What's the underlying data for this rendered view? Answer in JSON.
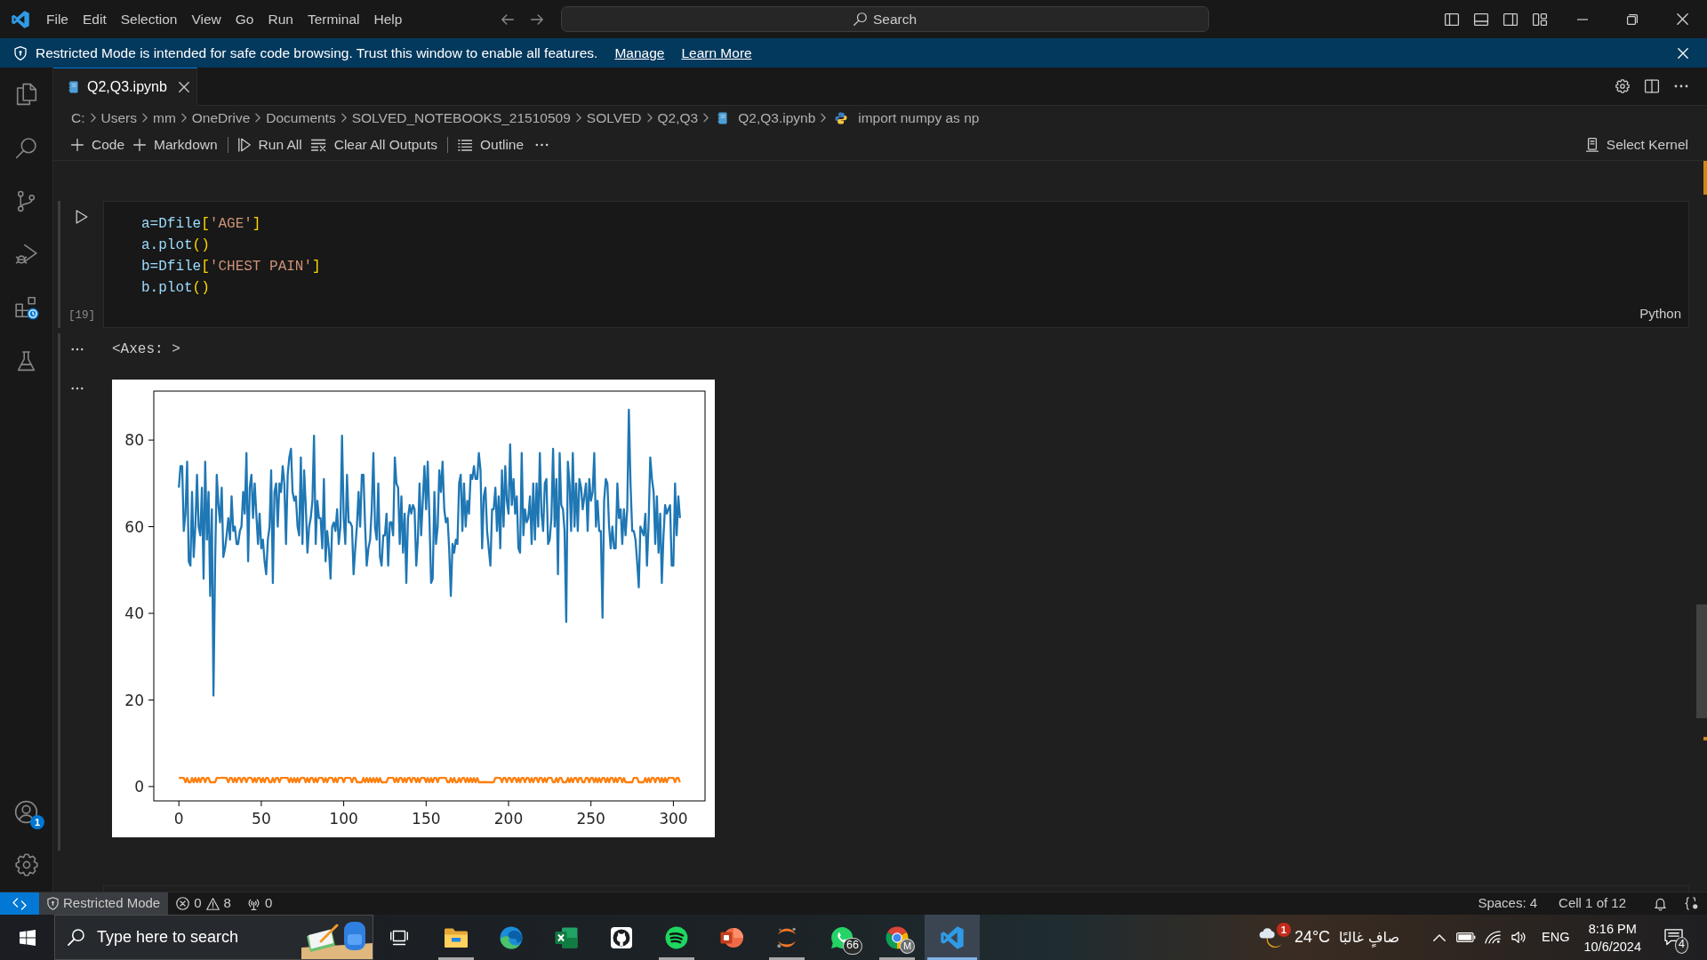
{
  "title_bar": {
    "menu": [
      "File",
      "Edit",
      "Selection",
      "View",
      "Go",
      "Run",
      "Terminal",
      "Help"
    ],
    "command_center": "Search"
  },
  "banner": {
    "message": "Restricted Mode is intended for safe code browsing. Trust this window to enable all features.",
    "links": [
      "Manage",
      "Learn More"
    ]
  },
  "activity_bar": {
    "accounts_badge": "1"
  },
  "tabs": [
    {
      "label": "Q2,Q3.ipynb",
      "selected": true
    }
  ],
  "breadcrumbs": [
    {
      "label": "C:",
      "kind": "folder"
    },
    {
      "label": "Users",
      "kind": "folder"
    },
    {
      "label": "mm",
      "kind": "folder"
    },
    {
      "label": "OneDrive",
      "kind": "folder"
    },
    {
      "label": "Documents",
      "kind": "folder"
    },
    {
      "label": "SOLVED_NOTEBOOKS_21510509",
      "kind": "folder"
    },
    {
      "label": "SOLVED",
      "kind": "folder"
    },
    {
      "label": "Q2,Q3",
      "kind": "folder"
    },
    {
      "label": "Q2,Q3.ipynb",
      "kind": "notebook"
    },
    {
      "label": "import numpy as np",
      "kind": "symbol"
    }
  ],
  "notebook_toolbar": {
    "groups": [
      [
        {
          "label": "Code",
          "kind": "add"
        },
        {
          "label": "Markdown",
          "kind": "add"
        }
      ],
      [
        {
          "label": "Run All",
          "kind": "run"
        },
        {
          "label": "Clear All Outputs",
          "kind": "clear"
        }
      ],
      [
        {
          "label": "Outline",
          "kind": "outline"
        }
      ]
    ],
    "kernel": "Select Kernel"
  },
  "cells": [
    {
      "execution_count": "[19]",
      "language": "Python",
      "code": [
        [
          {
            "text": "a=Dfile",
            "kind": "name"
          },
          {
            "text": "[",
            "kind": "bracket"
          },
          {
            "text": "'AGE'",
            "kind": "string"
          },
          {
            "text": "]",
            "kind": "bracket"
          }
        ],
        [
          {
            "text": "a.plot",
            "kind": "name"
          },
          {
            "text": "()",
            "kind": "bracket"
          }
        ],
        [
          {
            "text": "b=Dfile",
            "kind": "name"
          },
          {
            "text": "[",
            "kind": "bracket"
          },
          {
            "text": "'CHEST PAIN'",
            "kind": "string"
          },
          {
            "text": "]",
            "kind": "bracket"
          }
        ],
        [
          {
            "text": "b.plot",
            "kind": "name"
          },
          {
            "text": "()",
            "kind": "bracket"
          }
        ]
      ],
      "outputs": [
        {
          "kind": "text",
          "text": "<Axes: >"
        },
        {
          "kind": "image",
          "chart_data": {
            "type": "line",
            "xlim": [
              -15.2,
              319.2
            ],
            "ylim": [
              -3.3,
              91.3
            ],
            "xticks": [
              0,
              50,
              100,
              150,
              200,
              250,
              300
            ],
            "yticks": [
              0,
              20,
              40,
              60,
              80
            ],
            "x": [
              0,
              1,
              2,
              3,
              4,
              5,
              6,
              7,
              8,
              9,
              10,
              11,
              12,
              13,
              14,
              15,
              16,
              17,
              18,
              19,
              20,
              21,
              22,
              23,
              24,
              25,
              26,
              27,
              28,
              29,
              30,
              31,
              32,
              33,
              34,
              35,
              36,
              37,
              38,
              39,
              40,
              41,
              42,
              43,
              44,
              45,
              46,
              47,
              48,
              49,
              50,
              51,
              52,
              53,
              54,
              55,
              56,
              57,
              58,
              59,
              60,
              61,
              62,
              63,
              64,
              65,
              66,
              67,
              68,
              69,
              70,
              71,
              72,
              73,
              74,
              75,
              76,
              77,
              78,
              79,
              80,
              81,
              82,
              83,
              84,
              85,
              86,
              87,
              88,
              89,
              90,
              91,
              92,
              93,
              94,
              95,
              96,
              97,
              98,
              99,
              100,
              101,
              102,
              103,
              104,
              105,
              106,
              107,
              108,
              109,
              110,
              111,
              112,
              113,
              114,
              115,
              116,
              117,
              118,
              119,
              120,
              121,
              122,
              123,
              124,
              125,
              126,
              127,
              128,
              129,
              130,
              131,
              132,
              133,
              134,
              135,
              136,
              137,
              138,
              139,
              140,
              141,
              142,
              143,
              144,
              145,
              146,
              147,
              148,
              149,
              150,
              151,
              152,
              153,
              154,
              155,
              156,
              157,
              158,
              159,
              160,
              161,
              162,
              163,
              164,
              165,
              166,
              167,
              168,
              169,
              170,
              171,
              172,
              173,
              174,
              175,
              176,
              177,
              178,
              179,
              180,
              181,
              182,
              183,
              184,
              185,
              186,
              187,
              188,
              189,
              190,
              191,
              192,
              193,
              194,
              195,
              196,
              197,
              198,
              199,
              200,
              201,
              202,
              203,
              204,
              205,
              206,
              207,
              208,
              209,
              210,
              211,
              212,
              213,
              214,
              215,
              216,
              217,
              218,
              219,
              220,
              221,
              222,
              223,
              224,
              225,
              226,
              227,
              228,
              229,
              230,
              231,
              232,
              233,
              234,
              235,
              236,
              237,
              238,
              239,
              240,
              241,
              242,
              243,
              244,
              245,
              246,
              247,
              248,
              249,
              250,
              251,
              252,
              253,
              254,
              255,
              256,
              257,
              258,
              259,
              260,
              261,
              262,
              263,
              264,
              265,
              266,
              267,
              268,
              269,
              270,
              271,
              272,
              273,
              274,
              275,
              276,
              277,
              278,
              279,
              280,
              281,
              282,
              283,
              284,
              285,
              286,
              287,
              288,
              289,
              290,
              291,
              292,
              293,
              294,
              295,
              296,
              297,
              298,
              299,
              300,
              301,
              302,
              303,
              304
            ],
            "series": [
              {
                "color": "#1f77b4",
                "values": [
                  69,
                  74,
                  74,
                  59,
                  63,
                  75,
                  52,
                  51,
                  68,
                  53,
                  60,
                  72,
                  60,
                  58,
                  69,
                  48,
                  75,
                  57,
                  68,
                  44,
                  64,
                  21,
                  52,
                  72,
                  65,
                  61,
                  69,
                  53,
                  55,
                  58,
                  62,
                  57,
                  67,
                  59,
                  60,
                  56,
                  56,
                  59,
                  60,
                  68,
                  63,
                  77,
                  52,
                  69,
                  72,
                  62,
                  70,
                  63,
                  56,
                  63,
                  55,
                  57,
                  52,
                  49,
                  57,
                  60,
                  73,
                  47,
                  68,
                  70,
                  60,
                  70,
                  68,
                  74,
                  70,
                  56,
                  72,
                  76,
                  78,
                  68,
                  66,
                  67,
                  60,
                  58,
                  76,
                  56,
                  73,
                  65,
                  54,
                  60,
                  62,
                  66,
                  81,
                  56,
                  66,
                  62,
                  62,
                  55,
                  71,
                  52,
                  59,
                  55,
                  48,
                  60,
                  61,
                  59,
                  64,
                  56,
                  60,
                  81,
                  62,
                  56,
                  72,
                  61,
                  61,
                  60,
                  49,
                  55,
                  60,
                  68,
                  60,
                  72,
                  72,
                  60,
                  51,
                  55,
                  57,
                  64,
                  77,
                  60,
                  57,
                  70,
                  53,
                  51,
                  58,
                  58,
                  63,
                  51,
                  61,
                  61,
                  58,
                  76,
                  70,
                  69,
                  56,
                  67,
                  54,
                  63,
                  47,
                  62,
                  65,
                  63,
                  65,
                  64,
                  51,
                  57,
                  70,
                  58,
                  66,
                  74,
                  64,
                  75,
                  62,
                  47,
                  48,
                  68,
                  56,
                  60,
                  73,
                  68,
                  75,
                  64,
                  61,
                  62,
                  55,
                  44,
                  56,
                  54,
                  57,
                  56,
                  70,
                  72,
                  59,
                  70,
                  60,
                  66,
                  63,
                  72,
                  71,
                  74,
                  71,
                  71,
                  77,
                  73,
                  55,
                  67,
                  69,
                  59,
                  55,
                  51,
                  64,
                  64,
                  69,
                  59,
                  67,
                  55,
                  73,
                  60,
                  74,
                  66,
                  63,
                  79,
                  65,
                  71,
                  63,
                  67,
                  55,
                  54,
                  77,
                  58,
                  64,
                  61,
                  62,
                  67,
                  56,
                  70,
                  57,
                  70,
                  60,
                  77,
                  63,
                  59,
                  70,
                  71,
                  56,
                  57,
                  62,
                  78,
                  60,
                  71,
                  49,
                  77,
                  65,
                  64,
                  59,
                  38,
                  75,
                  70,
                  59,
                  77,
                  60,
                  70,
                  59,
                  71,
                  69,
                  64,
                  67,
                  70,
                  59,
                  71,
                  66,
                  68,
                  77,
                  60,
                  66,
                  59,
                  59,
                  39,
                  66,
                  71,
                  70,
                  60,
                  55,
                  60,
                  55,
                  55,
                  70,
                  62,
                  64,
                  56,
                  64,
                  58,
                  64,
                  87,
                  70,
                  59,
                  59,
                  57,
                  52,
                  46,
                  60,
                  59,
                  58,
                  63,
                  51,
                  61,
                  76,
                  71,
                  68,
                  56,
                  67,
                  54,
                  63,
                  47,
                  58,
                  65,
                  63,
                  64,
                  65,
                  51,
                  51,
                  70,
                  58,
                  67,
                  62
                ]
              },
              {
                "color": "#ff7f0e",
                "values": [
                  2,
                  2,
                  2,
                  2,
                  1,
                  2,
                  1,
                  1,
                  2,
                  1,
                  2,
                  1,
                  2,
                  1,
                  2,
                  2,
                  1,
                  2,
                  2,
                  1,
                  1,
                  1,
                  1,
                  2,
                  2,
                  2,
                  2,
                  2,
                  2,
                  2,
                  1,
                  2,
                  2,
                  1,
                  2,
                  1,
                  2,
                  2,
                  1,
                  2,
                  2,
                  1,
                  2,
                  2,
                  2,
                  1,
                  2,
                  1,
                  2,
                  2,
                  1,
                  2,
                  1,
                  2,
                  2,
                  1,
                  1,
                  2,
                  1,
                  2,
                  2,
                  1,
                  2,
                  2,
                  2,
                  2,
                  2,
                  1,
                  2,
                  1,
                  2,
                  1,
                  2,
                  1,
                  2,
                  2,
                  2,
                  1,
                  2,
                  1,
                  2,
                  2,
                  1,
                  2,
                  1,
                  2,
                  2,
                  2,
                  1,
                  2,
                  1,
                  2,
                  2,
                  2,
                  1,
                  2,
                  1,
                  2,
                  2,
                  2,
                  1,
                  2,
                  2,
                  2,
                  2,
                  1,
                  2,
                  2,
                  1,
                  1,
                  1,
                  1,
                  2,
                  1,
                  2,
                  1,
                  2,
                  1,
                  2,
                  1,
                  2,
                  1,
                  2,
                  1,
                  1,
                  1,
                  1,
                  2,
                  2,
                  2,
                  2,
                  1,
                  2,
                  1,
                  2,
                  2,
                  1,
                  2,
                  1,
                  2,
                  2,
                  1,
                  2,
                  2,
                  1,
                  2,
                  1,
                  2,
                  2,
                  2,
                  1,
                  2,
                  1,
                  2,
                  1,
                  2,
                  2,
                  1,
                  2,
                  2,
                  2,
                  2,
                  2,
                  1,
                  1,
                  2,
                  1,
                  2,
                  1,
                  1,
                  2,
                  1,
                  2,
                  2,
                  1,
                  2,
                  1,
                  2,
                  1,
                  2,
                  1,
                  2,
                  1,
                  1,
                  1,
                  1,
                  1,
                  1,
                  1,
                  1,
                  1,
                  1,
                  2,
                  2,
                  2,
                  2,
                  1,
                  2,
                  2,
                  1,
                  2,
                  2,
                  1,
                  2,
                  2,
                  1,
                  2,
                  1,
                  2,
                  2,
                  1,
                  2,
                  2,
                  1,
                  2,
                  1,
                  2,
                  2,
                  1,
                  2,
                  2,
                  1,
                  2,
                  1,
                  2,
                  2,
                  2,
                  1,
                  1,
                  2,
                  1,
                  2,
                  2,
                  1,
                  1,
                  1,
                  2,
                  1,
                  2,
                  1,
                  2,
                  2,
                  1,
                  2,
                  2,
                  1,
                  1,
                  2,
                  2,
                  1,
                  2,
                  2,
                  1,
                  2,
                  1,
                  2,
                  1,
                  2,
                  2,
                  1,
                  2,
                  1,
                  2,
                  2,
                  1,
                  2,
                  1,
                  2,
                  2,
                  1,
                  2,
                  1,
                  1,
                  1,
                  1,
                  1,
                  2,
                  2,
                  2,
                  1,
                  1,
                  1,
                  1,
                  2,
                  1,
                  2,
                  1,
                  2,
                  2,
                  1,
                  2,
                  2,
                  1,
                  2,
                  1,
                  2,
                  1,
                  2,
                  2,
                  2,
                  2,
                  1,
                  2,
                  2,
                  1
                ]
              }
            ]
          }
        }
      ]
    }
  ],
  "status_bar": {
    "restricted_mode": "Restricted Mode",
    "errors": "0",
    "warnings": "8",
    "ports": "0",
    "indentation": "Spaces: 4",
    "cell_position": "Cell 1 of 12"
  },
  "taskbar": {
    "search": {
      "placeholder": "Type here to search"
    },
    "apps": [
      {
        "kind": "files",
        "running": true,
        "active": false
      },
      {
        "kind": "browser",
        "running": false,
        "active": false
      },
      {
        "kind": "sheet",
        "running": false,
        "active": false
      },
      {
        "kind": "git",
        "running": false,
        "active": false
      },
      {
        "kind": "music",
        "running": true,
        "active": false
      },
      {
        "kind": "slides",
        "running": false,
        "active": false
      },
      {
        "kind": "arc",
        "running": true,
        "active": false
      },
      {
        "kind": "chat",
        "running": false,
        "active": false,
        "badge": "66"
      },
      {
        "kind": "globe",
        "running": true,
        "active": false,
        "profile": "M"
      },
      {
        "kind": "editor",
        "running": true,
        "active": true
      }
    ],
    "weather": {
      "temperature": "24°C",
      "condition": "صافٍ غالبًا",
      "badge": "1"
    },
    "language": "ENG",
    "time": "8:16 PM",
    "date": "10/6/2024",
    "notification_count": "4"
  }
}
